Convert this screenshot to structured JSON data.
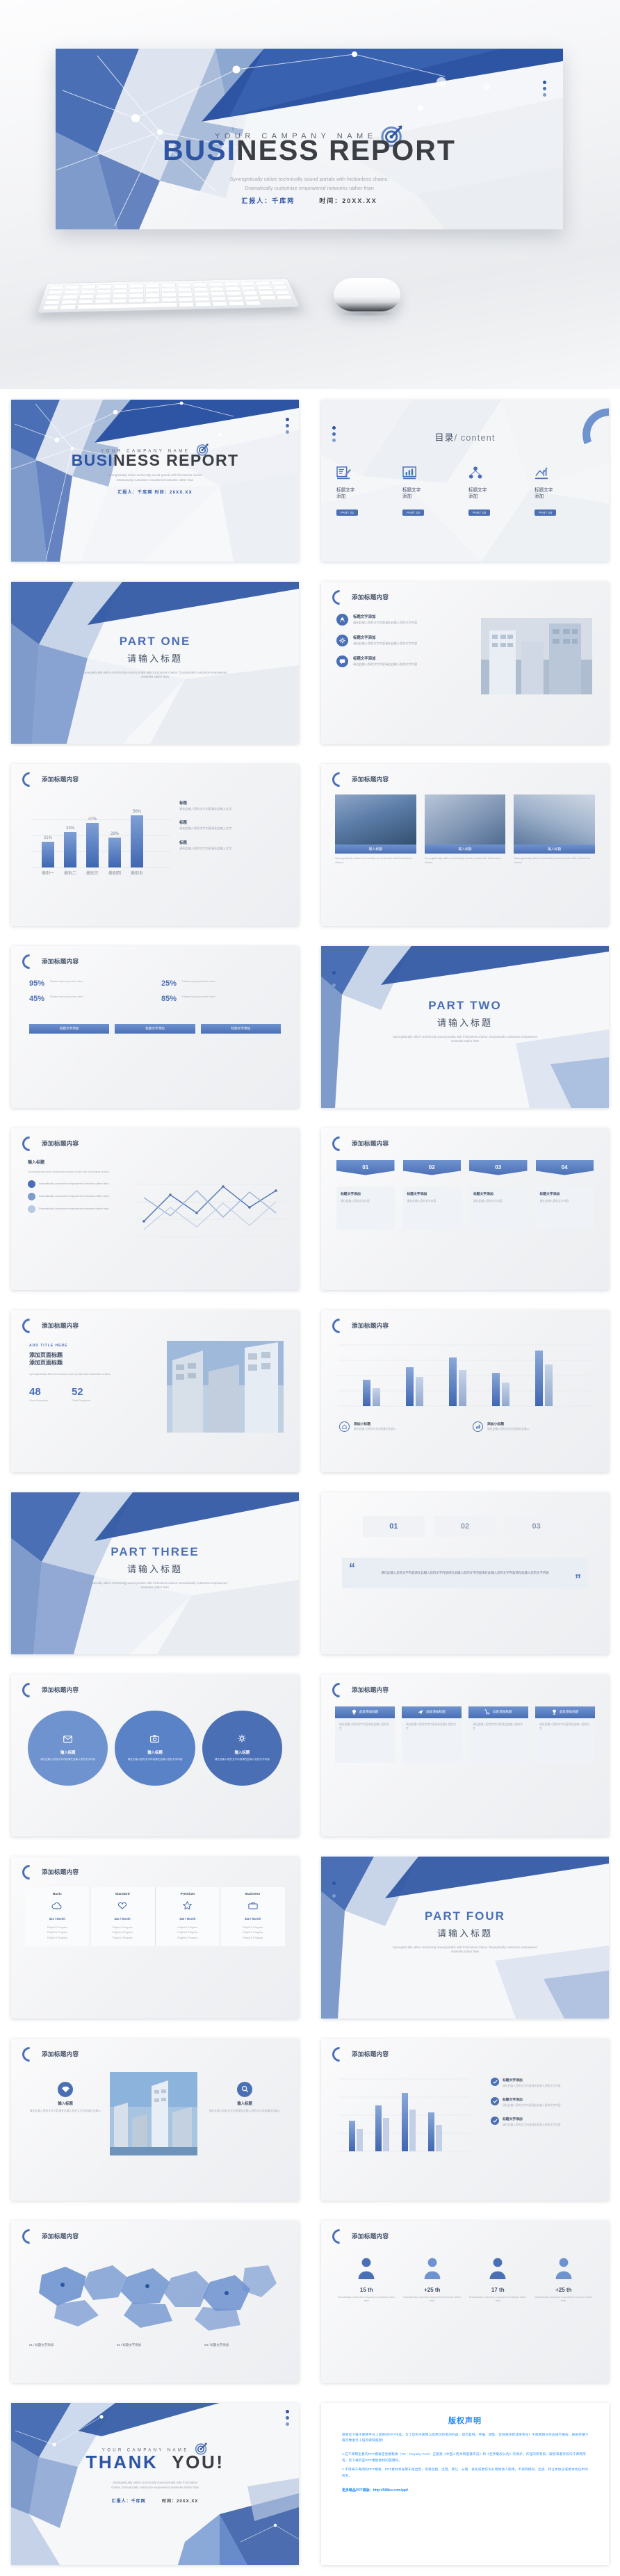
{
  "brand": {
    "accent": "#4a6fb5",
    "accent_dark": "#2e55a3",
    "ink": "#3b3f45",
    "muted": "#a3a8b0"
  },
  "hero": {
    "company": "YOUR  CAMPANY  NAME",
    "title_blue": "BUSI",
    "title_dark": "NESS  REPORT",
    "sub_line1": "Synergistically utilize technically sound portals with frictionless chains.",
    "sub_line2": "Dramatically customize empowered networks rather than",
    "meta_presenter": "汇报人：千库网",
    "meta_date": "时间：20XX.XX",
    "logo_icon": "target-arrow-icon",
    "keyboard_icon": "keyboard-mockup",
    "mouse_icon": "mouse-mockup"
  },
  "common": {
    "header_title": "添加标题内容",
    "header_icon": "arc-icon",
    "body_zh": "添加标题内容添加标题内容添加标题内容",
    "lorem_en": "Synergistically utilize technically sound portals with frictionless chains.",
    "lorem_en_short": "Dramatically customize empowered networks rather than",
    "placeholder_title": "标题文字添加",
    "placeholder_title_short": "输入标题",
    "btn_more": "PART 01"
  },
  "slides": [
    {
      "n": 1,
      "name": "cover-slide",
      "kind": "cover",
      "company": "YOUR CAMPANY NAME",
      "title_blue": "BUSI",
      "title_dark": "NESS  REPORT",
      "meta": "汇报人：千库网      时间：20XX.XX"
    },
    {
      "n": 2,
      "name": "toc-slide",
      "kind": "toc",
      "title_zh": "目录",
      "title_en": "/ content",
      "items": [
        {
          "icon": "document-edit-icon",
          "label": "标题文字\n添加",
          "btn": "PART 01"
        },
        {
          "icon": "bar-chart-icon",
          "label": "标题文字\n添加",
          "btn": "PART 02"
        },
        {
          "icon": "org-tree-icon",
          "label": "标题文字\n添加",
          "btn": "PART 03"
        },
        {
          "icon": "analytics-icon",
          "label": "标题文字\n添加",
          "btn": "PART 04"
        }
      ]
    },
    {
      "n": 3,
      "name": "part-one-divider",
      "kind": "divider",
      "eyebrow": "",
      "part": "PART ONE",
      "heading": "请输入标题",
      "sub": "Synergistically utilize technically sound portals with frictionless chains. Dramatically customize empowered networks rather than"
    },
    {
      "n": 4,
      "name": "list-with-photo-slide",
      "kind": "list-photo",
      "header": "添加标题内容",
      "rows": [
        {
          "icon": "rocket-icon",
          "title": "标题文字添加",
          "desc": "请在此输入您的文字内容请在此输入您的文字内容"
        },
        {
          "icon": "gear-icon",
          "title": "标题文字添加",
          "desc": "请在此输入您的文字内容请在此输入您的文字内容"
        },
        {
          "icon": "chat-icon",
          "title": "标题文字添加",
          "desc": "请在此输入您的文字内容请在此输入您的文字内容"
        }
      ],
      "photo": "office-building-photo"
    },
    {
      "n": 5,
      "name": "bar-chart-slide",
      "kind": "barchart",
      "header": "添加标题内容",
      "notes": [
        {
          "title": "标题",
          "desc": "请在此输入您的文字内容请在此输入文字"
        },
        {
          "title": "标题",
          "desc": "请在此输入您的文字内容请在此输入文字"
        },
        {
          "title": "标题",
          "desc": "请在此输入您的文字内容请在此输入文字"
        }
      ]
    },
    {
      "n": 6,
      "name": "three-photo-cards-slide",
      "kind": "photo3",
      "header": "添加标题内容",
      "cards": [
        {
          "caption": "输入标题",
          "photo": "handshake-photo"
        },
        {
          "caption": "输入标题",
          "photo": "laptop-photo"
        },
        {
          "caption": "输入标题",
          "photo": "meeting-photo"
        }
      ]
    },
    {
      "n": 7,
      "name": "percent-grid-slide",
      "kind": "percent",
      "header": "添加标题内容",
      "cells": [
        {
          "value": "95%",
          "desc": "Please input your text here"
        },
        {
          "value": "25%",
          "desc": "Please input your text here"
        },
        {
          "value": "45%",
          "desc": "Please input your text here"
        },
        {
          "value": "85%",
          "desc": "Please input your text here"
        }
      ],
      "tabs": [
        "标题文字添加",
        "标题文字添加",
        "标题文字添加"
      ]
    },
    {
      "n": 8,
      "name": "part-two-divider",
      "kind": "divider",
      "part": "PART  TWO",
      "heading": "请输入标题",
      "sub": "Synergistically utilize technically sound portals with frictionless chains. Dramatically customize empowered networks rather than"
    },
    {
      "n": 9,
      "name": "line-chart-slide",
      "kind": "linechart",
      "header": "添加标题内容",
      "title": "输入标题",
      "legend": [
        "标题",
        "标题",
        "标题"
      ]
    },
    {
      "n": 10,
      "name": "four-tabs-slide",
      "kind": "tabs4",
      "header": "添加标题内容",
      "tabs": [
        "01",
        "02",
        "03",
        "04"
      ],
      "cards": [
        {
          "title": "标题文字添加",
          "desc": "请在此输入您的文字内容"
        },
        {
          "title": "标题文字添加",
          "desc": "请在此输入您的文字内容"
        },
        {
          "title": "标题文字添加",
          "desc": "请在此输入您的文字内容"
        },
        {
          "title": "标题文字添加",
          "desc": "请在此输入您的文字内容"
        }
      ]
    },
    {
      "n": 11,
      "name": "stats-photo-slide",
      "kind": "stats-photo",
      "header": "添加标题内容",
      "kicker": "ADD TITLE HERE",
      "title": "添加页面标题\n添加页面标题",
      "stats": [
        {
          "value": "48",
          "label": "Cloud Greystone"
        },
        {
          "value": "52",
          "label": "Cloud Greystone"
        }
      ],
      "photo": "skyscraper-photo"
    },
    {
      "n": 12,
      "name": "column-chart-slide",
      "kind": "columnchart",
      "header": "添加标题内容",
      "legend": [
        {
          "title": "添加小标题",
          "desc": "请在此输入您的文字内容请在此输入"
        },
        {
          "title": "添加小标题",
          "desc": "请在此输入您的文字内容请在此输入"
        }
      ]
    },
    {
      "n": 13,
      "name": "part-three-divider",
      "kind": "divider",
      "part": "PART THREE",
      "heading": "请输入标题",
      "sub": "Synergistically utilize technically sound portals with frictionless chains. Dramatically customize empowered networks rather than"
    },
    {
      "n": 14,
      "name": "quote-steps-slide",
      "kind": "quote",
      "header": "",
      "steps": [
        "01",
        "02",
        "03"
      ],
      "quote": "请在此输入您的文字内容请在此输入您的文字内容请在此输入您的文字内容请在此输入您的文字内容请在此输入您的文字内容"
    },
    {
      "n": 15,
      "name": "three-circles-slide",
      "kind": "circles3",
      "header": "添加标题内容",
      "circles": [
        {
          "icon": "mail-icon",
          "title": "输入标题",
          "desc": "请在此输入您的文字内容请在此输入您的文字内容"
        },
        {
          "icon": "camera-icon",
          "title": "输入标题",
          "desc": "请在此输入您的文字内容请在此输入您的文字内容"
        },
        {
          "icon": "gear-icon",
          "title": "输入标题",
          "desc": "请在此输入您的文字内容请在此输入您的文字内容"
        }
      ]
    },
    {
      "n": 16,
      "name": "four-ribbon-cards-slide",
      "kind": "ribbon4",
      "header": "添加标题内容",
      "cards": [
        {
          "icon": "lightbulb-icon",
          "title": "此处添加标题",
          "desc": "请在此输入您的文字内容请在此输入您的文字"
        },
        {
          "icon": "plane-icon",
          "title": "此处添加标题",
          "desc": "请在此输入您的文字内容请在此输入您的文字"
        },
        {
          "icon": "cart-icon",
          "title": "此处添加标题",
          "desc": "请在此输入您的文字内容请在此输入您的文字"
        },
        {
          "icon": "trophy-icon",
          "title": "此处添加标题",
          "desc": "请在此输入您的文字内容请在此输入您的文字"
        }
      ]
    },
    {
      "n": 17,
      "name": "pricing-table-slide",
      "kind": "pricing",
      "header": "添加标题内容",
      "columns": [
        {
          "name": "Basic",
          "icon": "cloud-icon",
          "price": "$10 / Month",
          "rows": [
            "Playful & Program",
            "Playful & Program",
            "Playful & Program"
          ]
        },
        {
          "name": "Standard",
          "icon": "heart-icon",
          "price": "$20 / Month",
          "rows": [
            "Playful & Program",
            "Playful & Program",
            "Playful & Program"
          ]
        },
        {
          "name": "Premium",
          "icon": "star-icon",
          "price": "$30 / Month",
          "rows": [
            "Playful & Program",
            "Playful & Program",
            "Playful & Program"
          ]
        },
        {
          "name": "Business",
          "icon": "briefcase-icon",
          "price": "$40 / Month",
          "rows": [
            "Playful & Program",
            "Playful & Program",
            "Playful & Program"
          ]
        }
      ]
    },
    {
      "n": 18,
      "name": "part-four-divider",
      "kind": "divider",
      "part": "PART  FOUR",
      "heading": "请输入标题",
      "sub": "Synergistically utilize technically sound portals with frictionless chains. Dramatically customize empowered networks rather than"
    },
    {
      "n": 19,
      "name": "photo-two-col-slide",
      "kind": "photo2col",
      "header": "添加标题内容",
      "left": {
        "icon": "diamond-icon",
        "title": "输入标题",
        "desc": "请在此输入您的文字内容请在此输入您的文字内容请在此输入"
      },
      "right": {
        "icon": "search-icon",
        "title": "输入标题",
        "desc": "请在此输入您的文字内容请在此输入您的文字内容请在此输入"
      },
      "photo": "city-skyline-photo"
    },
    {
      "n": 20,
      "name": "bar-legend-slide",
      "kind": "barlegend",
      "header": "添加标题内容",
      "notes": [
        {
          "icon": "check-icon",
          "title": "标题文字添加",
          "desc": "请在此输入您的文字内容请在此输入您的文字内容"
        },
        {
          "icon": "check-icon",
          "title": "标题文字添加",
          "desc": "请在此输入您的文字内容请在此输入您的文字内容"
        },
        {
          "icon": "check-icon",
          "title": "标题文字添加",
          "desc": "请在此输入您的文字内容请在此输入您的文字内容"
        }
      ]
    },
    {
      "n": 21,
      "name": "map-slide",
      "kind": "map",
      "header": "添加标题内容",
      "regions": [
        "01 / 标题文字添加",
        "02 / 标题文字添加",
        "03 / 标题文字添加"
      ]
    },
    {
      "n": 22,
      "name": "people-counter-slide",
      "kind": "people",
      "header": "添加标题内容",
      "counters": [
        {
          "value": "15 th",
          "icon": "person-icon"
        },
        {
          "value": "+25 th",
          "icon": "person-icon"
        },
        {
          "value": "17 th",
          "icon": "person-icon"
        },
        {
          "value": "+25 th",
          "icon": "person-icon"
        }
      ]
    },
    {
      "n": 23,
      "name": "thank-you-slide",
      "kind": "thanks",
      "company": "YOUR  CAMPANY  NAME",
      "title_blue": "THANK",
      "title_dark": "YOU!",
      "sub_line1": "Synergistically utilize technically sound portals with frictionless",
      "sub_line2": "chains. Dramatically customize empowered networks rather than",
      "meta_presenter": "汇报人：千库网",
      "meta_date": "时间：20XX.XX"
    },
    {
      "n": 24,
      "name": "copyright-slide",
      "kind": "copyright",
      "title": "版权声明",
      "p1": "感谢您下载千库网平台上提供的PPT作品，为了您和千库网以及原创作者的利益，请勿复制、传播、销售，否则将承担法律责任！千库网将对作品进行维权，按照传播下载次数进行十倍的索取赔偿！",
      "p2": "1.在千库网出售的PPT模板是免版税类（RF：Royalty-Free）正版受《中国人民共和国著作法》和《世界版权公约》的保护，作品的所有权、版权和著作权归千库网所有，您下载的是PPT模板素材的使用权。",
      "p3": "2.不得将千库网的PPT模板、PPT素材本身用于再出售，或者出租、出借、转让、分销、发布或者作为礼物供他人使用，不得转授权、出卖、转让本协议或者本协议中的权利。",
      "p4": "更多精品PPT模板：http://588ku.com/ppt/"
    }
  ]
}
